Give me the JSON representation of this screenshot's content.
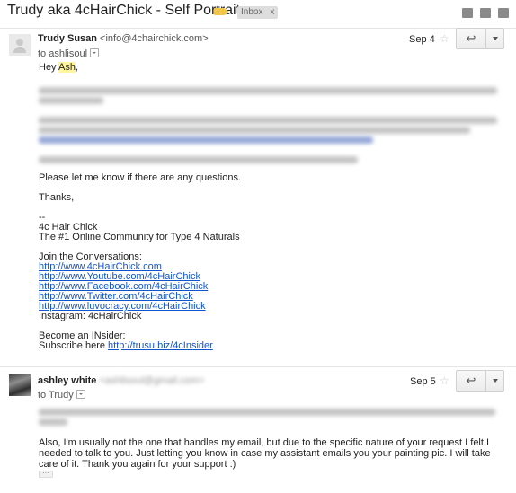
{
  "thread": {
    "subject": "Trudy aka 4cHairChick - Self Portrait",
    "label": "Inbox",
    "label_close": "x"
  },
  "icons": {
    "label": "important-marker-icon",
    "archive": "archive-icon",
    "print": "print-icon",
    "new_window": "new-window-icon",
    "reply": "reply-icon",
    "star": "star-icon"
  },
  "messages": [
    {
      "sender_name": "Trudy Susan",
      "sender_email": "<info@4chairchick.com>",
      "to_prefix": "to",
      "to": "ashlisoul",
      "date": "Sep 4",
      "greeting_prefix": "Hey ",
      "greeting_name": "Ash",
      "greeting_suffix": ",",
      "closing_question": "Please let me know if there are any questions.",
      "thanks": "Thanks,",
      "sig_dashes": "--",
      "sig_name": "4c Hair Chick",
      "sig_tagline": "The #1 Online Community for Type 4 Naturals",
      "join_label": "Join the Conversations:",
      "links": [
        "http://www.4cHairChick.com",
        "http://www.Youtube.com/4cHairChick",
        "http://www.Facebook.com/4cHairChick",
        "http://www.Twitter.com/4cHairChick",
        "http://www.luvocracy.com/4cHairChick"
      ],
      "instagram": "Instagram: 4cHairChick",
      "insider_label": "Become an INsider:",
      "subscribe_prefix": "Subscribe here ",
      "subscribe_link": "http://trusu.biz/4cInsider"
    },
    {
      "sender_name": "ashley white",
      "to_prefix": "to",
      "to": "Trudy",
      "date": "Sep 5",
      "paragraph": "Also, I'm usually not the one that handles my email, but due to the specific nature of your request I felt I needed to talk to you. Just letting you know in case my assistant emails you your painting pic. I will take care of it. Thank you again for your support :)",
      "trimmed": "···"
    }
  ],
  "colors": {
    "link": "#1155cc",
    "label_marker": "#f2c64a",
    "highlight": "#fff59d"
  }
}
